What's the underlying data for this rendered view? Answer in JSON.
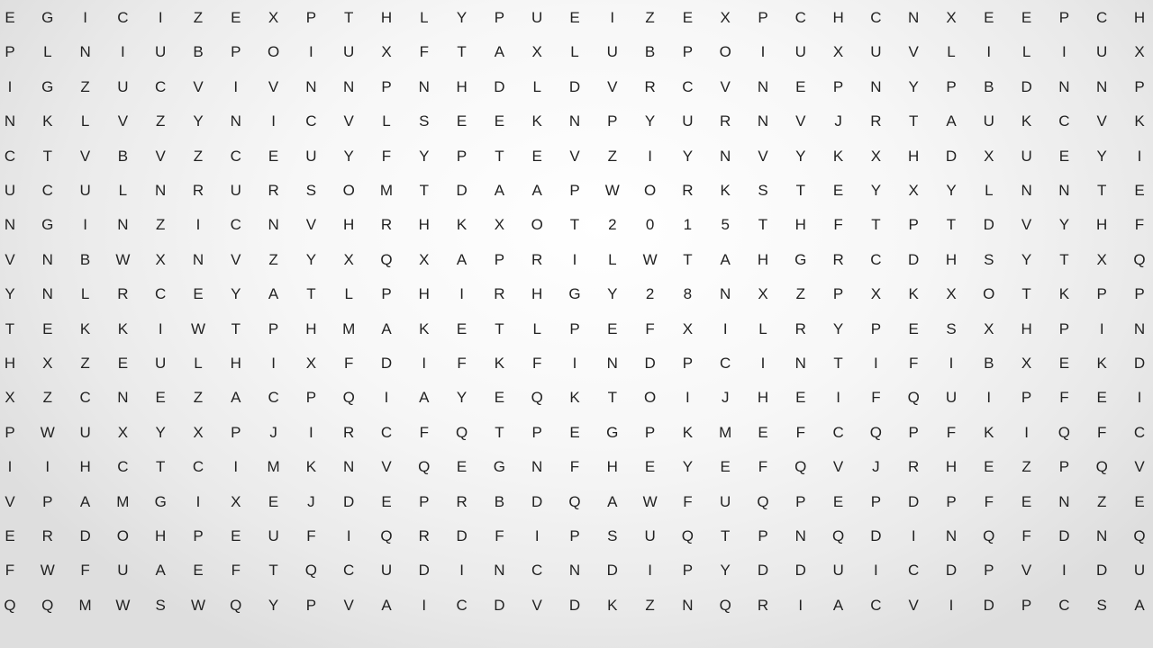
{
  "rows": [
    [
      "E",
      "G",
      "I",
      "C",
      "I",
      "Z",
      "E",
      "X",
      "P",
      "T",
      "H",
      "L",
      "Y",
      "P",
      "U",
      "E",
      "I",
      "Z",
      "E",
      "X",
      "P",
      "C",
      "H",
      "C",
      "N",
      "X",
      "E",
      "E",
      "P",
      "C",
      "H"
    ],
    [
      "P",
      "L",
      "N",
      "I",
      "U",
      "B",
      "P",
      "O",
      "I",
      "U",
      "X",
      "F",
      "T",
      "A",
      "X",
      "L",
      "U",
      "B",
      "P",
      "O",
      "I",
      "U",
      "X",
      "U",
      "V",
      "L",
      "I",
      "L",
      "I",
      "U",
      "X"
    ],
    [
      "I",
      "G",
      "Z",
      "U",
      "C",
      "V",
      "I",
      "V",
      "N",
      "N",
      "P",
      "N",
      "H",
      "D",
      "L",
      "D",
      "V",
      "R",
      "C",
      "V",
      "N",
      "E",
      "P",
      "N",
      "Y",
      "P",
      "B",
      "D",
      "N",
      "N",
      "P"
    ],
    [
      "N",
      "K",
      "L",
      "V",
      "Z",
      "Y",
      "N",
      "I",
      "C",
      "V",
      "L",
      "S",
      "E",
      "E",
      "K",
      "N",
      "P",
      "Y",
      "U",
      "R",
      "N",
      "V",
      "J",
      "R",
      "T",
      "A",
      "U",
      "K",
      "C",
      "V",
      "K"
    ],
    [
      "C",
      "T",
      "V",
      "B",
      "V",
      "Z",
      "C",
      "E",
      "U",
      "Y",
      "F",
      "Y",
      "P",
      "T",
      "E",
      "V",
      "Z",
      "I",
      "Y",
      "N",
      "V",
      "Y",
      "K",
      "X",
      "H",
      "D",
      "X",
      "U",
      "E",
      "Y",
      "I"
    ],
    [
      "U",
      "C",
      "U",
      "L",
      "N",
      "R",
      "U",
      "R",
      "S",
      "O",
      "M",
      "T",
      "D",
      "A",
      "A",
      "P",
      "W",
      "O",
      "R",
      "K",
      "S",
      "T",
      "E",
      "Y",
      "X",
      "Y",
      "L",
      "N",
      "N",
      "T",
      "E"
    ],
    [
      "N",
      "G",
      "I",
      "N",
      "Z",
      "I",
      "C",
      "N",
      "V",
      "H",
      "R",
      "H",
      "K",
      "X",
      "O",
      "T",
      "2",
      "0",
      "1",
      "5",
      "T",
      "H",
      "F",
      "T",
      "P",
      "T",
      "D",
      "V",
      "Y",
      "H",
      "F"
    ],
    [
      "V",
      "N",
      "B",
      "W",
      "X",
      "N",
      "V",
      "Z",
      "Y",
      "X",
      "Q",
      "X",
      "A",
      "P",
      "R",
      "I",
      "L",
      "W",
      "T",
      "A",
      "H",
      "G",
      "R",
      "C",
      "D",
      "H",
      "S",
      "Y",
      "T",
      "X",
      "Q"
    ],
    [
      "Y",
      "N",
      "L",
      "R",
      "C",
      "E",
      "Y",
      "A",
      "T",
      "L",
      "P",
      "H",
      "I",
      "R",
      "H",
      "G",
      "Y",
      "2",
      "8",
      "N",
      "X",
      "Z",
      "P",
      "X",
      "K",
      "X",
      "O",
      "T",
      "K",
      "P",
      "P"
    ],
    [
      "T",
      "E",
      "K",
      "K",
      "I",
      "W",
      "T",
      "P",
      "H",
      "M",
      "A",
      "K",
      "E",
      "T",
      "L",
      "P",
      "E",
      "F",
      "X",
      "I",
      "L",
      "R",
      "Y",
      "P",
      "E",
      "S",
      "X",
      "H",
      "P",
      "I",
      "N"
    ],
    [
      "H",
      "X",
      "Z",
      "E",
      "U",
      "L",
      "H",
      "I",
      "X",
      "F",
      "D",
      "I",
      "F",
      "K",
      "F",
      "I",
      "N",
      "D",
      "P",
      "C",
      "I",
      "N",
      "T",
      "I",
      "F",
      "I",
      "B",
      "X",
      "E",
      "K",
      "D"
    ],
    [
      "X",
      "Z",
      "C",
      "N",
      "E",
      "Z",
      "A",
      "C",
      "P",
      "Q",
      "I",
      "A",
      "Y",
      "E",
      "Q",
      "K",
      "T",
      "O",
      "I",
      "J",
      "H",
      "E",
      "I",
      "F",
      "Q",
      "U",
      "I",
      "P",
      "F",
      "E",
      "I"
    ],
    [
      "P",
      "W",
      "U",
      "X",
      "Y",
      "X",
      "P",
      "J",
      "I",
      "R",
      "C",
      "F",
      "Q",
      "T",
      "P",
      "E",
      "G",
      "P",
      "K",
      "M",
      "E",
      "F",
      "C",
      "Q",
      "P",
      "F",
      "K",
      "I",
      "Q",
      "F",
      "C"
    ],
    [
      "I",
      "I",
      "H",
      "C",
      "T",
      "C",
      "I",
      "M",
      "K",
      "N",
      "V",
      "Q",
      "E",
      "G",
      "N",
      "F",
      "H",
      "E",
      "Y",
      "E",
      "F",
      "Q",
      "V",
      "J",
      "R",
      "H",
      "E",
      "Z",
      "P",
      "Q",
      "V"
    ],
    [
      "V",
      "P",
      "A",
      "M",
      "G",
      "I",
      "X",
      "E",
      "J",
      "D",
      "E",
      "P",
      "R",
      "B",
      "D",
      "Q",
      "A",
      "W",
      "F",
      "U",
      "Q",
      "P",
      "E",
      "P",
      "D",
      "P",
      "F",
      "E",
      "N",
      "Z",
      "E"
    ],
    [
      "E",
      "R",
      "D",
      "O",
      "H",
      "P",
      "E",
      "U",
      "F",
      "I",
      "Q",
      "R",
      "D",
      "F",
      "I",
      "P",
      "S",
      "U",
      "Q",
      "T",
      "P",
      "N",
      "Q",
      "D",
      "I",
      "N",
      "Q",
      "F",
      "D",
      "N",
      "Q"
    ],
    [
      "F",
      "W",
      "F",
      "U",
      "A",
      "E",
      "F",
      "T",
      "Q",
      "C",
      "U",
      "D",
      "I",
      "N",
      "C",
      "N",
      "D",
      "I",
      "P",
      "Y",
      "D",
      "D",
      "U",
      "I",
      "C",
      "D",
      "P",
      "V",
      "I",
      "D",
      "U"
    ],
    [
      "Q",
      "Q",
      "M",
      "W",
      "S",
      "W",
      "Q",
      "Y",
      "P",
      "V",
      "A",
      "I",
      "C",
      "D",
      "V",
      "D",
      "K",
      "Z",
      "N",
      "Q",
      "R",
      "I",
      "A",
      "C",
      "V",
      "I",
      "D",
      "P",
      "C",
      "S",
      "A"
    ]
  ]
}
